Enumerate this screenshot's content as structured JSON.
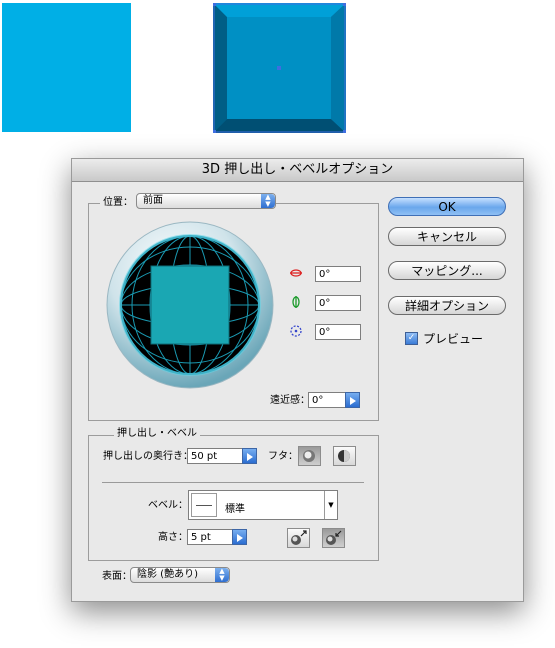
{
  "dialog": {
    "title": "3D 押し出し・ベベルオプション",
    "position": {
      "label": "位置：",
      "value": "前面",
      "x_rotation": "0°",
      "y_rotation": "0°",
      "z_rotation": "0°",
      "perspective_label": "遠近感：",
      "perspective_value": "0°"
    },
    "extrude": {
      "group_label": "押し出し・ベベル",
      "depth_label": "押し出しの奥行き：",
      "depth_value": "50 pt",
      "cap_label": "フタ：",
      "bevel_label": "ベベル：",
      "bevel_value": "標準",
      "height_label": "高さ：",
      "height_value": "5 pt"
    },
    "surface": {
      "label": "表面：",
      "value": "陰影 (艶あり)"
    },
    "buttons": {
      "ok": "OK",
      "cancel": "キャンセル",
      "mapping": "マッピング...",
      "more_options": "詳細オプション"
    },
    "preview": {
      "label": "プレビュー",
      "checked": true
    }
  },
  "colors": {
    "flat_square": "#00afe6",
    "extruded_face": "#0090c4",
    "trackball_face": "#1aa7b3",
    "default_button": "#6aa7ec"
  }
}
